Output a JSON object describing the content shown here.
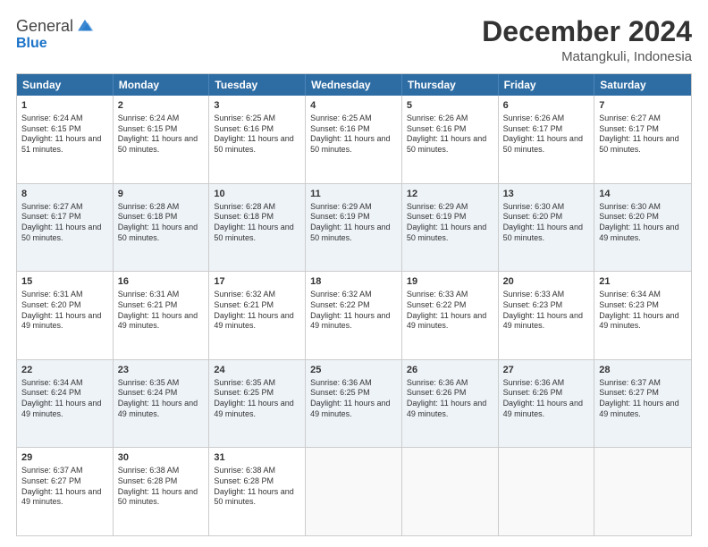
{
  "logo": {
    "general": "General",
    "blue": "Blue"
  },
  "title": "December 2024",
  "subtitle": "Matangkuli, Indonesia",
  "header_days": [
    "Sunday",
    "Monday",
    "Tuesday",
    "Wednesday",
    "Thursday",
    "Friday",
    "Saturday"
  ],
  "rows": [
    {
      "alt": false,
      "cells": [
        {
          "day": "1",
          "sunrise": "6:24 AM",
          "sunset": "6:15 PM",
          "daylight": "11 hours and 51 minutes."
        },
        {
          "day": "2",
          "sunrise": "6:24 AM",
          "sunset": "6:15 PM",
          "daylight": "11 hours and 50 minutes."
        },
        {
          "day": "3",
          "sunrise": "6:25 AM",
          "sunset": "6:16 PM",
          "daylight": "11 hours and 50 minutes."
        },
        {
          "day": "4",
          "sunrise": "6:25 AM",
          "sunset": "6:16 PM",
          "daylight": "11 hours and 50 minutes."
        },
        {
          "day": "5",
          "sunrise": "6:26 AM",
          "sunset": "6:16 PM",
          "daylight": "11 hours and 50 minutes."
        },
        {
          "day": "6",
          "sunrise": "6:26 AM",
          "sunset": "6:17 PM",
          "daylight": "11 hours and 50 minutes."
        },
        {
          "day": "7",
          "sunrise": "6:27 AM",
          "sunset": "6:17 PM",
          "daylight": "11 hours and 50 minutes."
        }
      ]
    },
    {
      "alt": true,
      "cells": [
        {
          "day": "8",
          "sunrise": "6:27 AM",
          "sunset": "6:17 PM",
          "daylight": "11 hours and 50 minutes."
        },
        {
          "day": "9",
          "sunrise": "6:28 AM",
          "sunset": "6:18 PM",
          "daylight": "11 hours and 50 minutes."
        },
        {
          "day": "10",
          "sunrise": "6:28 AM",
          "sunset": "6:18 PM",
          "daylight": "11 hours and 50 minutes."
        },
        {
          "day": "11",
          "sunrise": "6:29 AM",
          "sunset": "6:19 PM",
          "daylight": "11 hours and 50 minutes."
        },
        {
          "day": "12",
          "sunrise": "6:29 AM",
          "sunset": "6:19 PM",
          "daylight": "11 hours and 50 minutes."
        },
        {
          "day": "13",
          "sunrise": "6:30 AM",
          "sunset": "6:20 PM",
          "daylight": "11 hours and 50 minutes."
        },
        {
          "day": "14",
          "sunrise": "6:30 AM",
          "sunset": "6:20 PM",
          "daylight": "11 hours and 49 minutes."
        }
      ]
    },
    {
      "alt": false,
      "cells": [
        {
          "day": "15",
          "sunrise": "6:31 AM",
          "sunset": "6:20 PM",
          "daylight": "11 hours and 49 minutes."
        },
        {
          "day": "16",
          "sunrise": "6:31 AM",
          "sunset": "6:21 PM",
          "daylight": "11 hours and 49 minutes."
        },
        {
          "day": "17",
          "sunrise": "6:32 AM",
          "sunset": "6:21 PM",
          "daylight": "11 hours and 49 minutes."
        },
        {
          "day": "18",
          "sunrise": "6:32 AM",
          "sunset": "6:22 PM",
          "daylight": "11 hours and 49 minutes."
        },
        {
          "day": "19",
          "sunrise": "6:33 AM",
          "sunset": "6:22 PM",
          "daylight": "11 hours and 49 minutes."
        },
        {
          "day": "20",
          "sunrise": "6:33 AM",
          "sunset": "6:23 PM",
          "daylight": "11 hours and 49 minutes."
        },
        {
          "day": "21",
          "sunrise": "6:34 AM",
          "sunset": "6:23 PM",
          "daylight": "11 hours and 49 minutes."
        }
      ]
    },
    {
      "alt": true,
      "cells": [
        {
          "day": "22",
          "sunrise": "6:34 AM",
          "sunset": "6:24 PM",
          "daylight": "11 hours and 49 minutes."
        },
        {
          "day": "23",
          "sunrise": "6:35 AM",
          "sunset": "6:24 PM",
          "daylight": "11 hours and 49 minutes."
        },
        {
          "day": "24",
          "sunrise": "6:35 AM",
          "sunset": "6:25 PM",
          "daylight": "11 hours and 49 minutes."
        },
        {
          "day": "25",
          "sunrise": "6:36 AM",
          "sunset": "6:25 PM",
          "daylight": "11 hours and 49 minutes."
        },
        {
          "day": "26",
          "sunrise": "6:36 AM",
          "sunset": "6:26 PM",
          "daylight": "11 hours and 49 minutes."
        },
        {
          "day": "27",
          "sunrise": "6:36 AM",
          "sunset": "6:26 PM",
          "daylight": "11 hours and 49 minutes."
        },
        {
          "day": "28",
          "sunrise": "6:37 AM",
          "sunset": "6:27 PM",
          "daylight": "11 hours and 49 minutes."
        }
      ]
    },
    {
      "alt": false,
      "cells": [
        {
          "day": "29",
          "sunrise": "6:37 AM",
          "sunset": "6:27 PM",
          "daylight": "11 hours and 49 minutes."
        },
        {
          "day": "30",
          "sunrise": "6:38 AM",
          "sunset": "6:28 PM",
          "daylight": "11 hours and 50 minutes."
        },
        {
          "day": "31",
          "sunrise": "6:38 AM",
          "sunset": "6:28 PM",
          "daylight": "11 hours and 50 minutes."
        },
        {
          "day": "",
          "sunrise": "",
          "sunset": "",
          "daylight": ""
        },
        {
          "day": "",
          "sunrise": "",
          "sunset": "",
          "daylight": ""
        },
        {
          "day": "",
          "sunrise": "",
          "sunset": "",
          "daylight": ""
        },
        {
          "day": "",
          "sunrise": "",
          "sunset": "",
          "daylight": ""
        }
      ]
    }
  ]
}
